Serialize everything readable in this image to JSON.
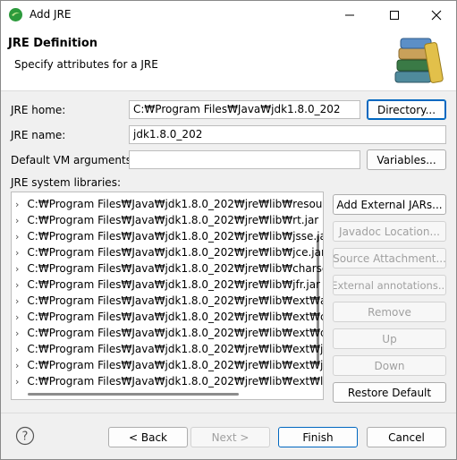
{
  "window": {
    "title": "Add JRE"
  },
  "header": {
    "title": "JRE Definition",
    "subtitle": "Specify attributes for a JRE"
  },
  "form": {
    "jre_home_label": "JRE home:",
    "jre_home_value": "C:₩Program Files₩Java₩jdk1.8.0_202",
    "directory_button": "Directory...",
    "jre_name_label": "JRE name:",
    "jre_name_value": "jdk1.8.0_202",
    "vm_args_label": "Default VM arguments:",
    "vm_args_value": "",
    "variables_button": "Variables...",
    "libraries_label": "JRE system libraries:"
  },
  "libraries": [
    "C:₩Program Files₩Java₩jdk1.8.0_202₩jre₩lib₩resourc",
    "C:₩Program Files₩Java₩jdk1.8.0_202₩jre₩lib₩rt.jar",
    "C:₩Program Files₩Java₩jdk1.8.0_202₩jre₩lib₩jsse.jar",
    "C:₩Program Files₩Java₩jdk1.8.0_202₩jre₩lib₩jce.jar",
    "C:₩Program Files₩Java₩jdk1.8.0_202₩jre₩lib₩charsets",
    "C:₩Program Files₩Java₩jdk1.8.0_202₩jre₩lib₩jfr.jar",
    "C:₩Program Files₩Java₩jdk1.8.0_202₩jre₩lib₩ext₩acc",
    "C:₩Program Files₩Java₩jdk1.8.0_202₩jre₩lib₩ext₩cld",
    "C:₩Program Files₩Java₩jdk1.8.0_202₩jre₩lib₩ext₩dn",
    "C:₩Program Files₩Java₩jdk1.8.0_202₩jre₩lib₩ext₩jac",
    "C:₩Program Files₩Java₩jdk1.8.0_202₩jre₩lib₩ext₩jfx",
    "C:₩Program Files₩Java₩jdk1.8.0_202₩jre₩lib₩ext₩loc"
  ],
  "side_buttons": {
    "add_external_jars": "Add External JARs...",
    "javadoc_location": "Javadoc Location...",
    "source_attachment": "Source Attachment...",
    "external_annotations": "External annotations...",
    "remove": "Remove",
    "up": "Up",
    "down": "Down",
    "restore_default": "Restore Default"
  },
  "footer": {
    "back": "< Back",
    "next": "Next >",
    "finish": "Finish",
    "cancel": "Cancel"
  },
  "colors": {
    "accent": "#0067c0"
  }
}
